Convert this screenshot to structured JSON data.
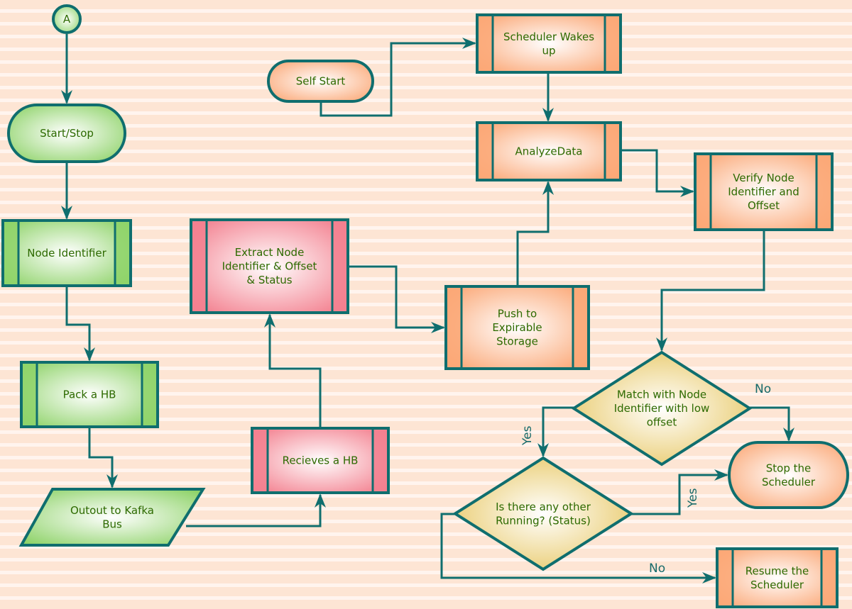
{
  "diagram": {
    "colors": {
      "stroke": "#0f6e6e",
      "text": "#2d6a00",
      "green": "#8fd36a",
      "orange": "#fba877",
      "pink": "#f3808f",
      "yellow": "#e6c45a"
    },
    "nodes": [
      {
        "id": "a",
        "shape": "circle",
        "theme": "green",
        "lines": [
          "A"
        ]
      },
      {
        "id": "start",
        "shape": "terminal",
        "theme": "green",
        "lines": [
          "Start/Stop"
        ]
      },
      {
        "id": "nodeid",
        "shape": "process",
        "theme": "green",
        "lines": [
          "Node Identifier"
        ]
      },
      {
        "id": "pack",
        "shape": "process",
        "theme": "green",
        "lines": [
          "Pack a HB"
        ]
      },
      {
        "id": "kafka",
        "shape": "parallelogram",
        "theme": "green",
        "lines": [
          "Outout to Kafka",
          "Bus"
        ]
      },
      {
        "id": "recv",
        "shape": "process",
        "theme": "pink",
        "lines": [
          "Recieves a HB"
        ]
      },
      {
        "id": "extract",
        "shape": "process",
        "theme": "pink",
        "lines": [
          "Extract Node",
          "Identifier & Offset",
          "& Status"
        ]
      },
      {
        "id": "selfstart",
        "shape": "terminal",
        "theme": "orange",
        "lines": [
          "Self Start"
        ]
      },
      {
        "id": "wakes",
        "shape": "process",
        "theme": "orange",
        "lines": [
          "Scheduler Wakes",
          "up"
        ]
      },
      {
        "id": "analyze",
        "shape": "process",
        "theme": "orange",
        "lines": [
          "AnalyzeData"
        ]
      },
      {
        "id": "push",
        "shape": "process",
        "theme": "orange",
        "lines": [
          "Push to",
          "Expirable",
          "Storage"
        ]
      },
      {
        "id": "verify",
        "shape": "process",
        "theme": "orange",
        "lines": [
          "Verify Node",
          "Identifier and",
          "Offset"
        ]
      },
      {
        "id": "d1",
        "shape": "diamond",
        "theme": "yellow",
        "lines": [
          "Match with Node",
          "Identifier with low",
          "offset"
        ]
      },
      {
        "id": "stop",
        "shape": "terminal",
        "theme": "orange",
        "lines": [
          "Stop the",
          "Scheduler"
        ]
      },
      {
        "id": "d2",
        "shape": "diamond",
        "theme": "yellow",
        "lines": [
          "Is there any other",
          "Running? (Status)"
        ]
      },
      {
        "id": "resume",
        "shape": "process",
        "theme": "orange",
        "lines": [
          "Resume the",
          "Scheduler"
        ]
      }
    ],
    "edges": [
      {
        "from": "a",
        "to": "start",
        "label": ""
      },
      {
        "from": "start",
        "to": "nodeid",
        "label": ""
      },
      {
        "from": "nodeid",
        "to": "pack",
        "label": ""
      },
      {
        "from": "pack",
        "to": "kafka",
        "label": ""
      },
      {
        "from": "kafka",
        "to": "recv",
        "label": ""
      },
      {
        "from": "recv",
        "to": "extract",
        "label": ""
      },
      {
        "from": "extract",
        "to": "push",
        "label": ""
      },
      {
        "from": "push",
        "to": "analyze",
        "label": ""
      },
      {
        "from": "selfstart",
        "to": "wakes",
        "label": ""
      },
      {
        "from": "wakes",
        "to": "analyze",
        "label": ""
      },
      {
        "from": "analyze",
        "to": "verify",
        "label": ""
      },
      {
        "from": "verify",
        "to": "d1",
        "label": ""
      },
      {
        "from": "d1",
        "to": "stop",
        "label": "No"
      },
      {
        "from": "d1",
        "to": "d2",
        "label": "Yes"
      },
      {
        "from": "d2",
        "to": "stop",
        "label": "Yes"
      },
      {
        "from": "d2",
        "to": "resume",
        "label": "No"
      }
    ]
  }
}
